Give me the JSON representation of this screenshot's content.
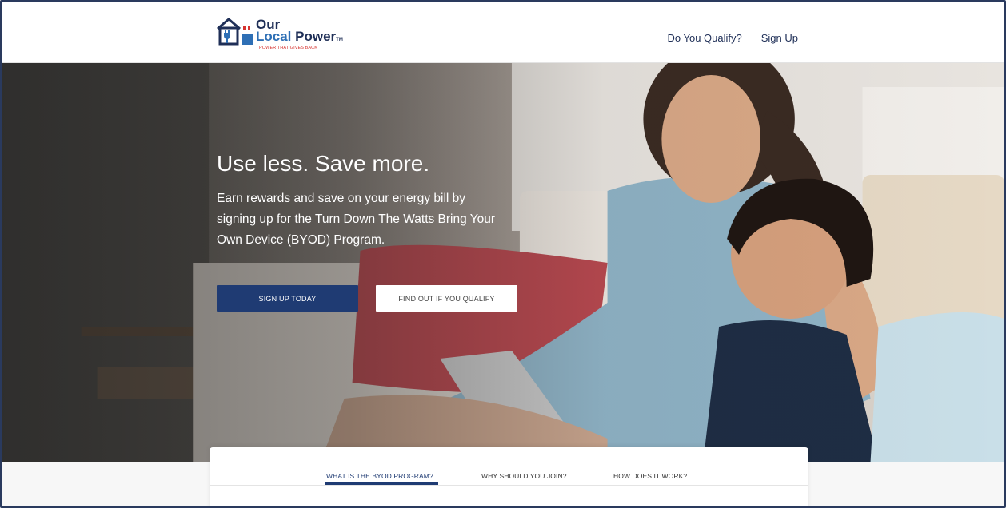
{
  "logo": {
    "line1": "Our",
    "line2a": "Local",
    "line2b": " Power",
    "tm": "TM",
    "tagline": "POWER THAT GIVES BACK"
  },
  "nav": {
    "qualify": "Do You Qualify?",
    "signup": "Sign Up"
  },
  "hero": {
    "title": "Use less. Save more.",
    "subtitle": "Earn rewards and save on your energy bill by signing up for the Turn Down The Watts Bring Your Own Device (BYOD) Program.",
    "primary_button": "SIGN UP TODAY",
    "secondary_button": "FIND OUT IF YOU QUALIFY"
  },
  "tabs": [
    {
      "label": "WHAT IS THE BYOD PROGRAM?",
      "active": true
    },
    {
      "label": "WHY SHOULD YOU JOIN?",
      "active": false
    },
    {
      "label": "HOW DOES IT WORK?",
      "active": false
    }
  ],
  "colors": {
    "brand_navy": "#1f3b73",
    "brand_blue": "#2e6fb5",
    "brand_red": "#d6332f"
  }
}
